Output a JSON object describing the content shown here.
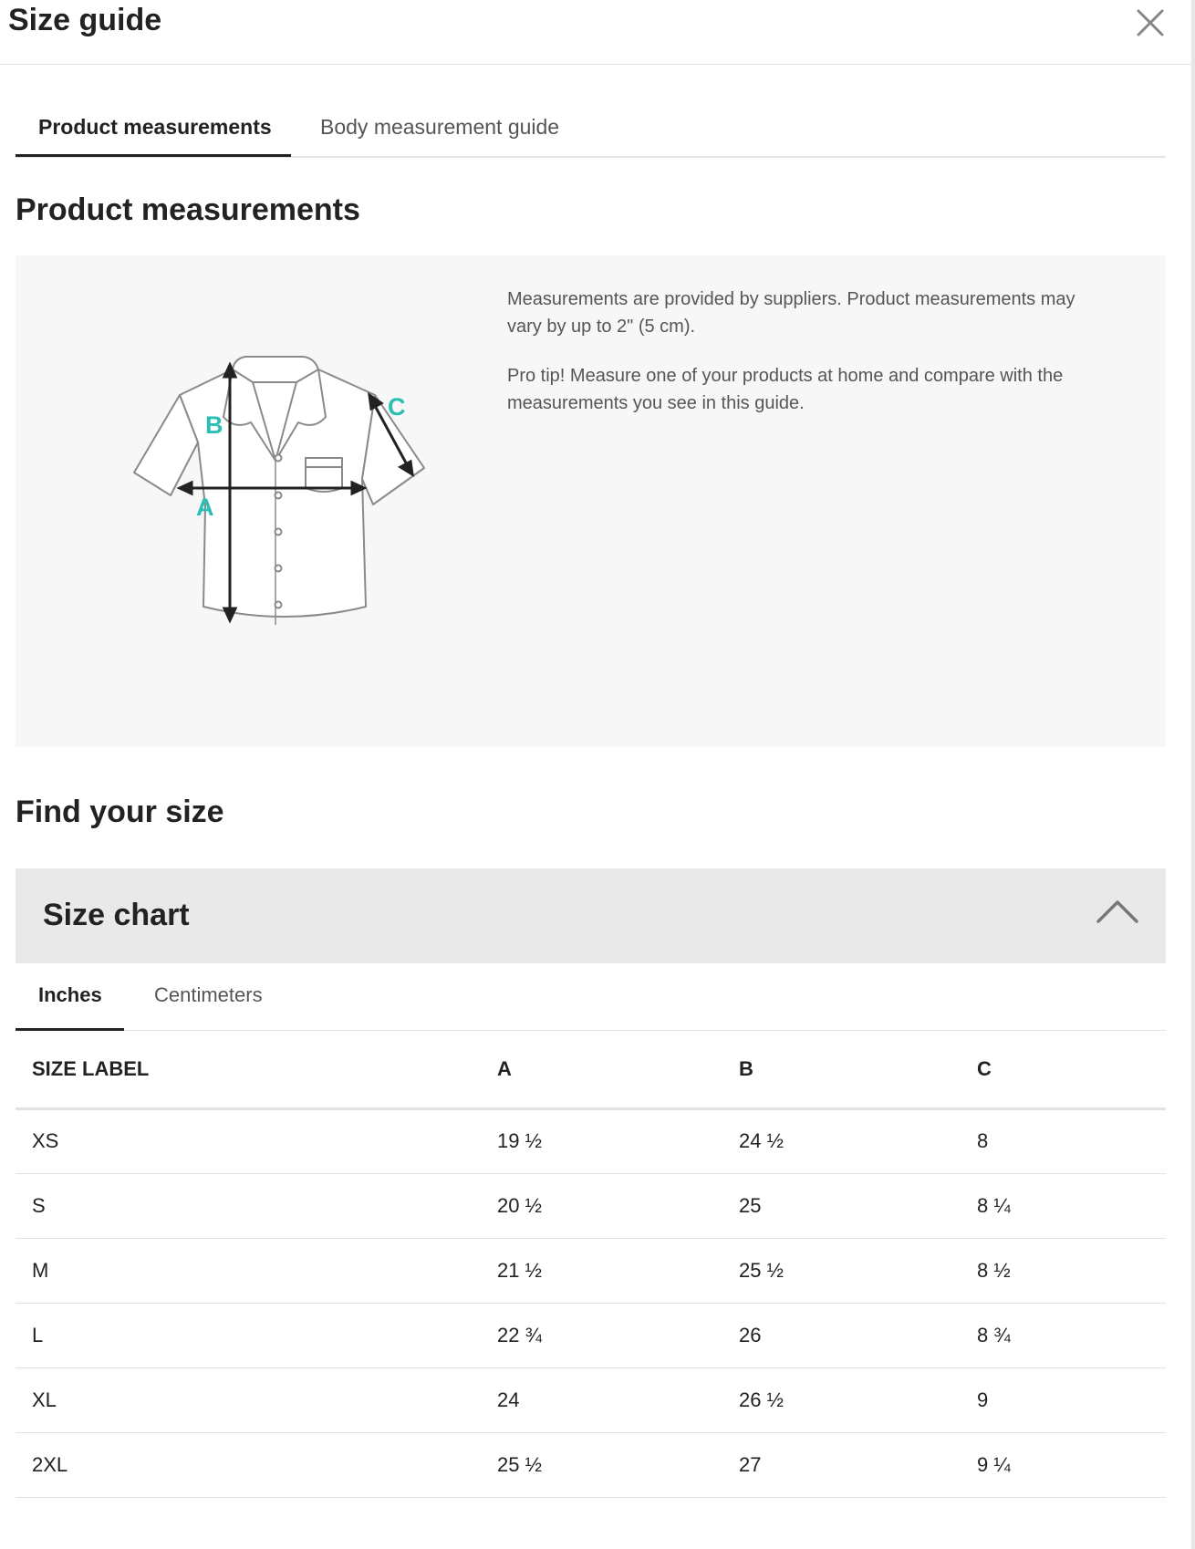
{
  "modal": {
    "title": "Size guide"
  },
  "tabs": [
    {
      "label": "Product measurements",
      "active": true
    },
    {
      "label": "Body measurement guide",
      "active": false
    }
  ],
  "product_measurements": {
    "heading": "Product measurements",
    "diagram": {
      "labels": {
        "a": "A",
        "b": "B",
        "c": "C"
      },
      "accent_color": "#2bbfb3"
    },
    "note": "Measurements are provided by suppliers. Product measurements may vary by up to 2\" (5 cm).",
    "tip": "Pro tip! Measure one of your products at home and compare with the measurements you see in this guide."
  },
  "find_size": {
    "heading": "Find your size",
    "chart_title": "Size chart",
    "chart_expanded": true,
    "unit_tabs": [
      {
        "label": "Inches",
        "active": true
      },
      {
        "label": "Centimeters",
        "active": false
      }
    ],
    "columns": [
      "SIZE LABEL",
      "A",
      "B",
      "C"
    ],
    "rows": [
      {
        "size": "XS",
        "a": "19 ½",
        "b": "24 ½",
        "c": "8"
      },
      {
        "size": "S",
        "a": "20 ½",
        "b": "25",
        "c": "8 ¼"
      },
      {
        "size": "M",
        "a": "21 ½",
        "b": "25 ½",
        "c": "8 ½"
      },
      {
        "size": "L",
        "a": "22 ¾",
        "b": "26",
        "c": "8 ¾"
      },
      {
        "size": "XL",
        "a": "24",
        "b": "26 ½",
        "c": "9"
      },
      {
        "size": "2XL",
        "a": "25 ½",
        "b": "27",
        "c": "9 ¼"
      }
    ]
  }
}
